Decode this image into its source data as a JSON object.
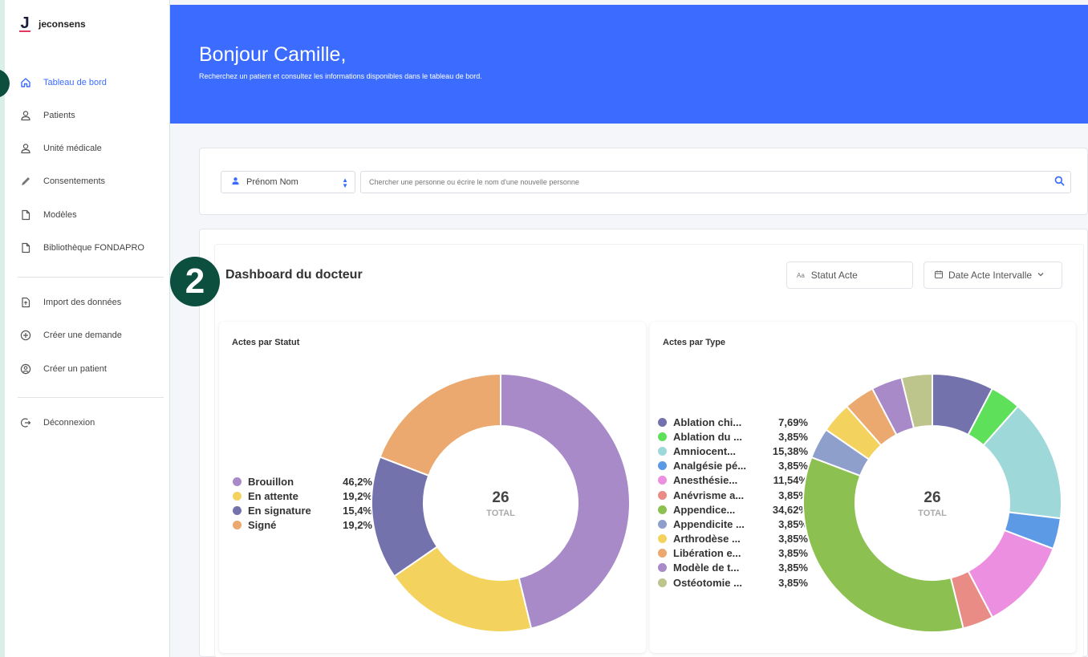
{
  "app": {
    "logo_mark": "J",
    "logo_text": "jeconsens"
  },
  "sidebar": {
    "items": [
      {
        "label": "Tableau de bord",
        "icon": "home-icon",
        "active": true
      },
      {
        "label": "Patients",
        "icon": "user-icon"
      },
      {
        "label": "Unité médicale",
        "icon": "user-icon"
      },
      {
        "label": "Consentements",
        "icon": "pen-icon"
      },
      {
        "label": "Modèles",
        "icon": "file-icon"
      },
      {
        "label": "Bibliothèque FONDAPRO",
        "icon": "file-icon"
      }
    ],
    "items2": [
      {
        "label": "Import des données",
        "icon": "import-icon"
      },
      {
        "label": "Créer une demande",
        "icon": "plus-circle-icon"
      },
      {
        "label": "Créer un patient",
        "icon": "user-circle-icon"
      }
    ],
    "logout": {
      "label": "Déconnexion",
      "icon": "logout-icon"
    }
  },
  "hero": {
    "title": "Bonjour Camille,",
    "subtitle": "Recherchez un patient et consultez les informations disponibles dans le tableau de bord."
  },
  "search": {
    "select_value": "Prénom Nom",
    "placeholder": "Chercher une personne ou écrire le nom d'une nouvelle personne"
  },
  "dashboard": {
    "badge": "2",
    "title": "Dashboard du docteur",
    "filter_status": "Statut Acte",
    "filter_status_icon": "Aa",
    "filter_date": "Date Acte Intervalle"
  },
  "chart_data": [
    {
      "type": "pie",
      "title": "Actes par Statut",
      "center_value": "26",
      "center_label": "TOTAL",
      "legend_position": "left",
      "categories": [
        "Brouillon",
        "En attente",
        "En signature",
        "Signé"
      ],
      "values": [
        46.2,
        19.2,
        15.4,
        19.2
      ],
      "labels": [
        "46,2%",
        "19,2%",
        "15,4%",
        "19,2%"
      ],
      "colors": [
        "#a78ac7",
        "#f3d35e",
        "#7372ad",
        "#eba86f"
      ]
    },
    {
      "type": "pie",
      "title": "Actes par Type",
      "center_value": "26",
      "center_label": "TOTAL",
      "legend_position": "left",
      "categories": [
        "Ablation chi...",
        "Ablation du ...",
        "Amniocent...",
        "Analgésie pé...",
        "Anesthésie...",
        "Anévrisme a...",
        "Appendice...",
        "Appendicite ...",
        "Arthrodèse ...",
        "Libération e...",
        "Modèle de t...",
        "Ostéotomie ..."
      ],
      "values": [
        7.69,
        3.85,
        15.38,
        3.85,
        11.54,
        3.85,
        34.62,
        3.85,
        3.85,
        3.85,
        3.85,
        3.85
      ],
      "labels": [
        "7,69%",
        "3,85%",
        "15,38%",
        "3,85%",
        "11,54%",
        "3,85%",
        "34,62%",
        "3,85%",
        "3,85%",
        "3,85%",
        "3,85%",
        "3,85%"
      ],
      "colors": [
        "#7372ad",
        "#5fe05a",
        "#9fd8d9",
        "#5c9ae6",
        "#ec8fe0",
        "#ea8c86",
        "#8cc152",
        "#8e9fcc",
        "#f3d35e",
        "#eba86f",
        "#a78ac7",
        "#bdc48c"
      ]
    }
  ]
}
